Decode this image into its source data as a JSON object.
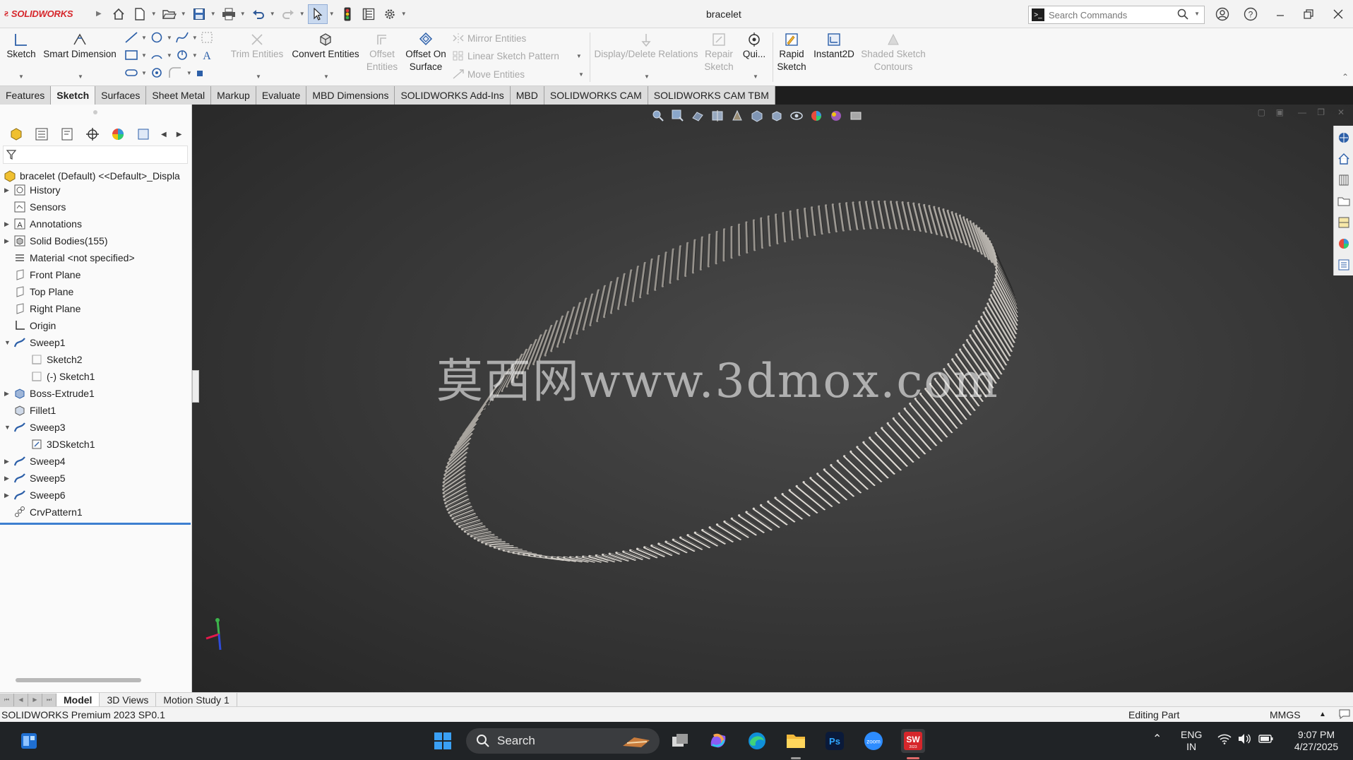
{
  "app": {
    "brand": "SOLIDWORKS",
    "document_title": "bracelet",
    "search_placeholder": "Search Commands"
  },
  "ribbon": {
    "sketch": "Sketch",
    "smart_dimension": "Smart Dimension",
    "trim_entities": "Trim Entities",
    "convert_entities": "Convert Entities",
    "offset_entities": "Offset Entities",
    "offset_on_surface": "Offset On Surface",
    "mirror_entities": "Mirror Entities",
    "linear_sketch_pattern": "Linear Sketch Pattern",
    "move_entities": "Move Entities",
    "display_delete_relations": "Display/Delete Relations",
    "repair_sketch": "Repair Sketch",
    "quick_snaps": "Qui...",
    "rapid_sketch": "Rapid Sketch",
    "instant2d": "Instant2D",
    "shaded_sketch_contours": "Shaded Sketch Contours"
  },
  "tabs": [
    "Features",
    "Sketch",
    "Surfaces",
    "Sheet Metal",
    "Markup",
    "Evaluate",
    "MBD Dimensions",
    "SOLIDWORKS Add-Ins",
    "MBD",
    "SOLIDWORKS CAM",
    "SOLIDWORKS CAM TBM"
  ],
  "active_tab": "Sketch",
  "tree": {
    "root": "bracelet (Default) <<Default>_Displa",
    "items": [
      {
        "label": "History"
      },
      {
        "label": "Sensors"
      },
      {
        "label": "Annotations"
      },
      {
        "label": "Solid Bodies(155)"
      },
      {
        "label": "Material <not specified>"
      },
      {
        "label": "Front Plane"
      },
      {
        "label": "Top Plane"
      },
      {
        "label": "Right Plane"
      },
      {
        "label": "Origin"
      },
      {
        "label": "Sweep1"
      },
      {
        "label": "Sketch2"
      },
      {
        "label": "(-) Sketch1"
      },
      {
        "label": "Boss-Extrude1"
      },
      {
        "label": "Fillet1"
      },
      {
        "label": "Sweep3"
      },
      {
        "label": "3DSketch1"
      },
      {
        "label": "Sweep4"
      },
      {
        "label": "Sweep5"
      },
      {
        "label": "Sweep6"
      },
      {
        "label": "CrvPattern1"
      }
    ]
  },
  "viewport": {
    "watermark": "莫西网www.3dmox.com"
  },
  "bottom_tabs": [
    "Model",
    "3D Views",
    "Motion Study 1"
  ],
  "status": {
    "product": "SOLIDWORKS Premium 2023 SP0.1",
    "mode": "Editing Part",
    "units": "MMGS"
  },
  "taskbar": {
    "search_label": "Search",
    "lang_top": "ENG",
    "lang_bottom": "IN",
    "time": "9:07 PM",
    "date": "4/27/2025"
  },
  "colors": {
    "brand_red": "#d6262b",
    "viewport_bg": "#3b3b3b",
    "tree_highlight": "#3d7fd0",
    "taskbar_bg": "#202326"
  }
}
